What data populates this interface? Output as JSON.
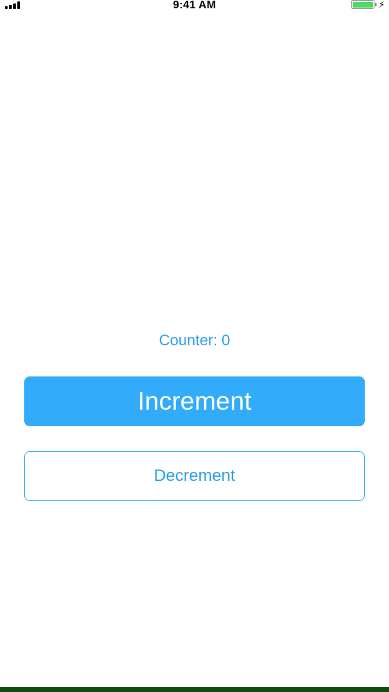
{
  "status_bar": {
    "time": "9:41 AM",
    "signal_icon": "signal-bars-icon",
    "battery_icon": "battery-full-icon",
    "charging_icon": "lightning-bolt-icon",
    "battery_color": "#4cd964"
  },
  "counter": {
    "label": "Counter: 0",
    "color": "#2f9ee8"
  },
  "buttons": {
    "increment_label": "Increment",
    "decrement_label": "Decrement",
    "accent_color": "#33abfb"
  },
  "bottom_bar_color": "#0d4d12"
}
